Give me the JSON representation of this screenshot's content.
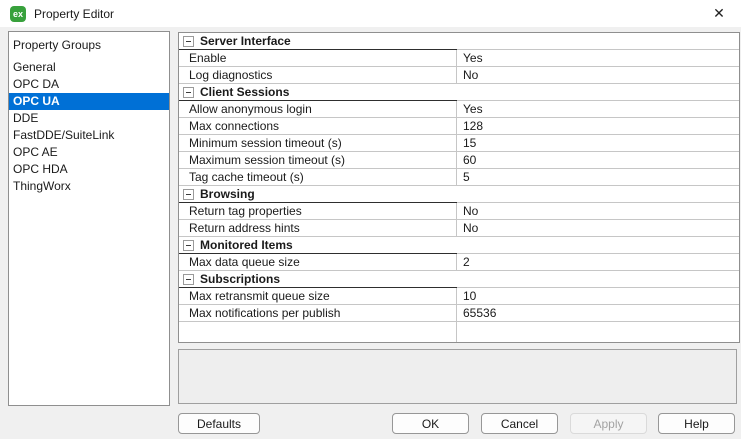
{
  "window": {
    "title": "Property Editor",
    "app_icon_text": "ex",
    "close_glyph": "✕"
  },
  "sidebar": {
    "header": "Property Groups",
    "items": [
      {
        "label": "General",
        "selected": false
      },
      {
        "label": "OPC DA",
        "selected": false
      },
      {
        "label": "OPC UA",
        "selected": true
      },
      {
        "label": "DDE",
        "selected": false
      },
      {
        "label": "FastDDE/SuiteLink",
        "selected": false
      },
      {
        "label": "OPC AE",
        "selected": false
      },
      {
        "label": "OPC HDA",
        "selected": false
      },
      {
        "label": "ThingWorx",
        "selected": false
      }
    ]
  },
  "property_grid": {
    "rows": [
      {
        "type": "category",
        "label": "Server Interface"
      },
      {
        "type": "property",
        "name": "Enable",
        "value": "Yes"
      },
      {
        "type": "property",
        "name": "Log diagnostics",
        "value": "No"
      },
      {
        "type": "category",
        "label": "Client Sessions"
      },
      {
        "type": "property",
        "name": "Allow anonymous login",
        "value": "Yes"
      },
      {
        "type": "property",
        "name": "Max connections",
        "value": "128"
      },
      {
        "type": "property",
        "name": "Minimum session timeout (s)",
        "value": "15"
      },
      {
        "type": "property",
        "name": "Maximum session timeout (s)",
        "value": "60"
      },
      {
        "type": "property",
        "name": "Tag cache timeout (s)",
        "value": "5"
      },
      {
        "type": "category",
        "label": "Browsing"
      },
      {
        "type": "property",
        "name": "Return tag properties",
        "value": "No"
      },
      {
        "type": "property",
        "name": "Return address hints",
        "value": "No"
      },
      {
        "type": "category",
        "label": "Monitored Items"
      },
      {
        "type": "property",
        "name": "Max data queue size",
        "value": "2"
      },
      {
        "type": "category",
        "label": "Subscriptions"
      },
      {
        "type": "property",
        "name": "Max retransmit queue size",
        "value": "10"
      },
      {
        "type": "property",
        "name": "Max notifications per publish",
        "value": "65536"
      },
      {
        "type": "empty",
        "name": "",
        "value": ""
      }
    ]
  },
  "description_panel": {
    "text": ""
  },
  "buttons": {
    "defaults": {
      "label": "Defaults",
      "enabled": true
    },
    "ok": {
      "label": "OK",
      "enabled": true
    },
    "cancel": {
      "label": "Cancel",
      "enabled": true
    },
    "apply": {
      "label": "Apply",
      "enabled": false
    },
    "help": {
      "label": "Help",
      "enabled": true
    }
  },
  "colors": {
    "selection_blue": "#0070d6",
    "app_icon_green": "#38a13c",
    "titlebar_bg": "#ffffff",
    "dialog_bg": "#f0f0f0"
  }
}
